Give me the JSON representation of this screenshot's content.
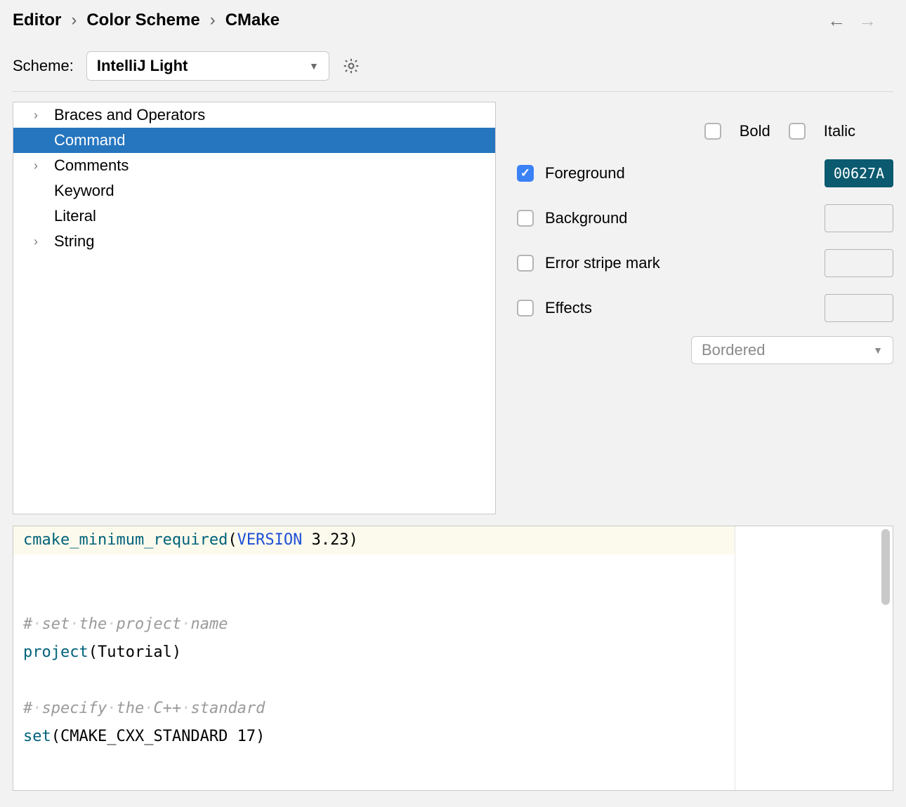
{
  "breadcrumb": {
    "a": "Editor",
    "b": "Color Scheme",
    "c": "CMake"
  },
  "scheme": {
    "label": "Scheme:",
    "value": "IntelliJ Light"
  },
  "tree": {
    "items": [
      {
        "label": "Braces and Operators",
        "expandable": true
      },
      {
        "label": "Command",
        "expandable": false,
        "selected": true
      },
      {
        "label": "Comments",
        "expandable": true
      },
      {
        "label": "Keyword",
        "expandable": false
      },
      {
        "label": "Literal",
        "expandable": false
      },
      {
        "label": "String",
        "expandable": true
      }
    ]
  },
  "opts": {
    "bold": "Bold",
    "italic": "Italic",
    "foreground": {
      "label": "Foreground",
      "checked": true,
      "value": "00627A"
    },
    "background": {
      "label": "Background",
      "checked": false
    },
    "errorstripe": {
      "label": "Error stripe mark",
      "checked": false
    },
    "effects": {
      "label": "Effects",
      "checked": false,
      "select": "Bordered"
    }
  },
  "preview": {
    "l1_cmd": "cmake_minimum_required",
    "l1_op": "(",
    "l1_kw": "VERSION",
    "l1_rest": " 3.23)",
    "l3_comment": "# set the project name",
    "l4_cmd": "project",
    "l4_rest": "(Tutorial)",
    "l6_comment": "# specify the C++ standard",
    "l7_cmd": "set",
    "l7_rest": "(CMAKE_CXX_STANDARD 17)"
  }
}
